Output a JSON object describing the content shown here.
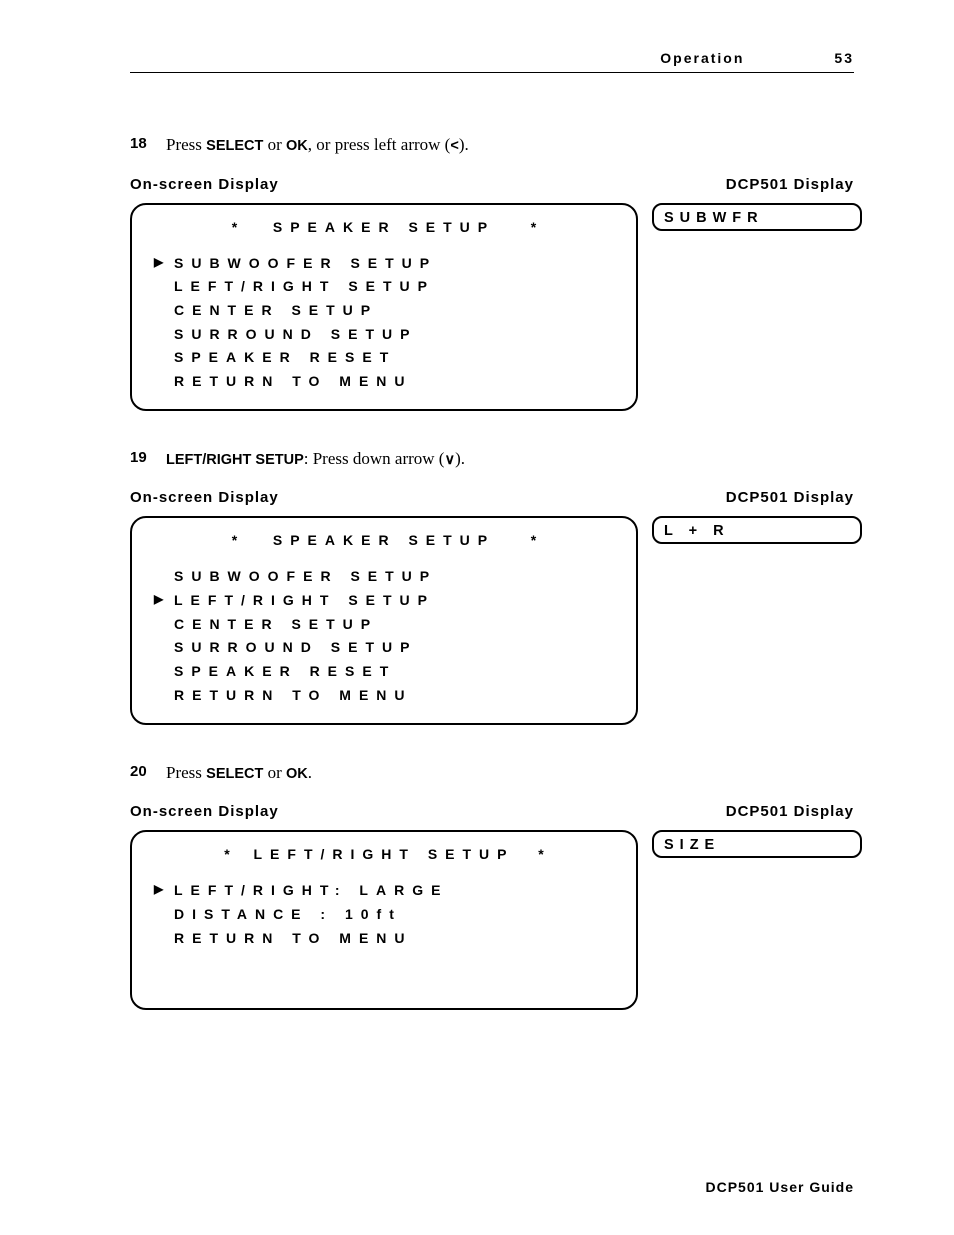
{
  "header": {
    "section": "Operation",
    "page": "53"
  },
  "step18": {
    "num": "18",
    "pre": "Press ",
    "k1": "SELECT",
    "mid1": " or ",
    "k2": "OK",
    "mid2": ", or press left arrow (",
    "k3": "<",
    "post": ")."
  },
  "labels": {
    "onscreen": "On-screen Display",
    "dcp": "DCP501 Display"
  },
  "block18": {
    "title": "SPEAKER SETUP",
    "lines": [
      {
        "sel": true,
        "text": "SUBWOOFER SETUP"
      },
      {
        "sel": false,
        "text": "LEFT/RIGHT SETUP"
      },
      {
        "sel": false,
        "text": "CENTER SETUP"
      },
      {
        "sel": false,
        "text": "SURROUND SETUP"
      },
      {
        "sel": false,
        "text": "SPEAKER RESET"
      },
      {
        "sel": false,
        "text": "RETURN TO MENU"
      }
    ],
    "dcp": "SUBWFR"
  },
  "step19": {
    "num": "19",
    "k0": "LEFT/RIGHT SETUP",
    "mid0": ": Press down arrow (",
    "k1": "∨",
    "post": ")."
  },
  "block19": {
    "title": "SPEAKER SETUP",
    "lines": [
      {
        "sel": false,
        "text": "SUBWOOFER SETUP"
      },
      {
        "sel": true,
        "text": "LEFT/RIGHT SETUP"
      },
      {
        "sel": false,
        "text": "CENTER SETUP"
      },
      {
        "sel": false,
        "text": "SURROUND SETUP"
      },
      {
        "sel": false,
        "text": "SPEAKER RESET"
      },
      {
        "sel": false,
        "text": "RETURN TO MENU"
      }
    ],
    "dcp": "L + R"
  },
  "step20": {
    "num": "20",
    "pre": "Press ",
    "k1": "SELECT",
    "mid1": " or ",
    "k2": "OK",
    "post": "."
  },
  "block20": {
    "title": "LEFT/RIGHT SETUP",
    "lines": [
      {
        "sel": true,
        "text": "LEFT/RIGHT: LARGE"
      },
      {
        "sel": false,
        "text": "DISTANCE  : 10ft"
      },
      {
        "sel": false,
        "text": "RETURN TO MENU"
      }
    ],
    "dcp": "SIZE"
  },
  "footer": "DCP501 User Guide"
}
